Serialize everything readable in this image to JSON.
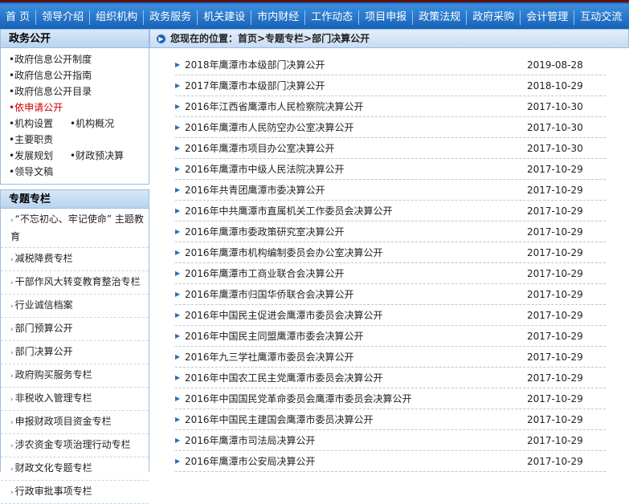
{
  "nav": [
    "首 页",
    "领导介绍",
    "组织机构",
    "政务服务",
    "机关建设",
    "市内财经",
    "工作动态",
    "项目申报",
    "政策法规",
    "政府采购",
    "会计管理",
    "互动交流"
  ],
  "sidebar": {
    "panel1_title": "政务公开",
    "items": [
      "•政府信息公开制度",
      "•政府信息公开指南",
      "•政府信息公开目录"
    ],
    "red_item": "•依申请公开",
    "pair1": [
      "•机构设置",
      "•机构概况"
    ],
    "item_duty": "•主要职责",
    "pair2": [
      "•发展规划",
      "•财政预决算"
    ],
    "item_speech": "•领导文稿",
    "panel2_title": "专题专栏",
    "topics": [
      "“不忘初心、牢记使命” 主题教育",
      "减税降费专栏",
      "干部作风大转变教育整治专栏",
      "行业诚信档案",
      "部门预算公开",
      "部门决算公开",
      "政府购买服务专栏",
      "非税收入管理专栏",
      "申报财政项目资金专栏",
      "涉农资金专项治理行动专栏",
      "财政文化专题专栏",
      "行政审批事项专栏"
    ]
  },
  "breadcrumb": "您现在的位置：首页>专题专栏>部门决算公开",
  "rows": [
    {
      "title": "2018年鹰潭市本级部门决算公开",
      "date": "2019-08-28"
    },
    {
      "title": "2017年鹰潭市本级部门决算公开",
      "date": "2018-10-29"
    },
    {
      "title": "2016年江西省鹰潭市人民检察院决算公开",
      "date": "2017-10-30"
    },
    {
      "title": "2016年鹰潭市人民防空办公室决算公开",
      "date": "2017-10-30"
    },
    {
      "title": "2016年鹰潭市项目办公室决算公开",
      "date": "2017-10-30"
    },
    {
      "title": "2016年鹰潭市中级人民法院决算公开",
      "date": "2017-10-29"
    },
    {
      "title": "2016年共青团鹰潭市委决算公开",
      "date": "2017-10-29"
    },
    {
      "title": "2016年中共鹰潭市直属机关工作委员会决算公开",
      "date": "2017-10-29"
    },
    {
      "title": "2016年鹰潭市委政策研究室决算公开",
      "date": "2017-10-29"
    },
    {
      "title": "2016年鹰潭市机构编制委员会办公室决算公开",
      "date": "2017-10-29"
    },
    {
      "title": "2016年鹰潭市工商业联合会决算公开",
      "date": "2017-10-29"
    },
    {
      "title": "2016年鹰潭市归国华侨联合会决算公开",
      "date": "2017-10-29"
    },
    {
      "title": "2016年中国民主促进会鹰潭市委员会决算公开",
      "date": "2017-10-29"
    },
    {
      "title": "2016年中国民主同盟鹰潭市委会决算公开",
      "date": "2017-10-29"
    },
    {
      "title": "2016年九三学社鹰潭市委员会决算公开",
      "date": "2017-10-29"
    },
    {
      "title": "2016年中国农工民主党鹰潭市委员会决算公开",
      "date": "2017-10-29"
    },
    {
      "title": "2016年中国国民党革命委员会鹰潭市委员会决算公开",
      "date": "2017-10-29"
    },
    {
      "title": "2016年中国民主建国会鹰潭市委员决算公开",
      "date": "2017-10-29"
    },
    {
      "title": "2016年鹰潭市司法局决算公开",
      "date": "2017-10-29"
    },
    {
      "title": "2016年鹰潭市公安局决算公开",
      "date": "2017-10-29"
    }
  ]
}
